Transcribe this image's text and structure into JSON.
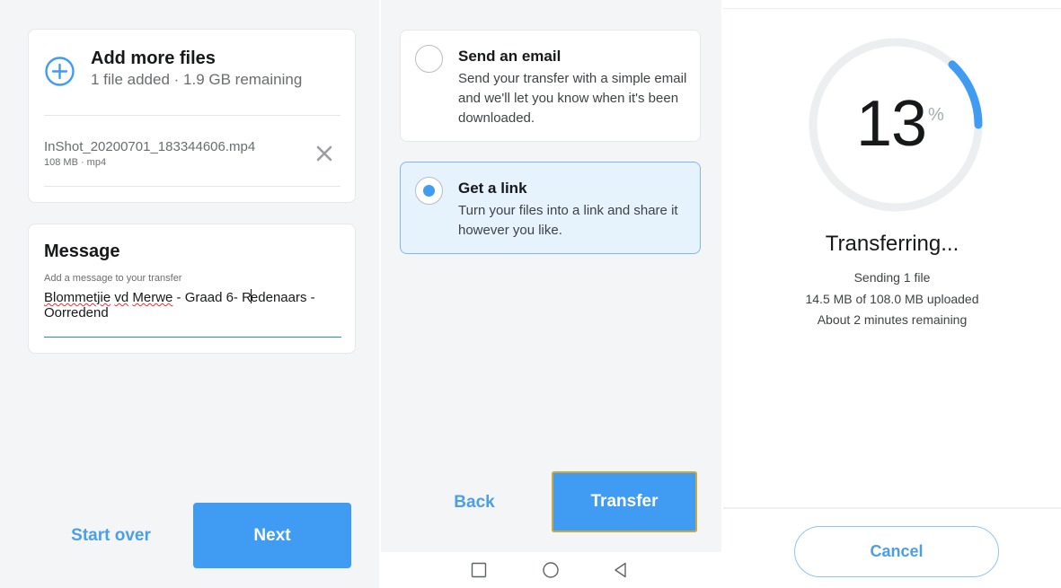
{
  "upload_step": {
    "add_files": {
      "title": "Add more files",
      "subtitle": "1 file added · 1.9 GB remaining",
      "icon": "plus-circle-icon"
    },
    "file": {
      "name": "InShot_20200701_183344606.mp4",
      "meta": "108 MB · mp4",
      "remove_icon": "close-icon"
    },
    "message": {
      "title": "Message",
      "hint": "Add a message to your transfer",
      "value_parts": [
        "Blommetjie",
        " ",
        "vd",
        " ",
        "Merwe",
        " - Graad 6- R",
        "edenaars - Oorredend"
      ]
    },
    "start_over_label": "Start over",
    "next_label": "Next"
  },
  "delivery_step": {
    "options": [
      {
        "title": "Send an email",
        "description": "Send your transfer with a simple email and we'll let you know when it's been downloaded.",
        "selected": false
      },
      {
        "title": "Get a link",
        "description": "Turn your files into a link and share it however you like.",
        "selected": true
      }
    ],
    "back_label": "Back",
    "transfer_label": "Transfer",
    "nav_icons": [
      "recents-square-icon",
      "home-circle-icon",
      "back-triangle-icon"
    ]
  },
  "progress_step": {
    "percent": 13,
    "percent_text": "13",
    "percent_symbol": "%",
    "title": "Transferring...",
    "sending": "Sending 1 file",
    "uploaded": "14.5 MB of 108.0 MB uploaded",
    "remaining": "About 2 minutes remaining",
    "cancel_label": "Cancel"
  },
  "colors": {
    "accent": "#409cf2",
    "accent_text": "#4a9fe6",
    "selected_bg": "#e6f2fc",
    "spellcheck": "#e0322f",
    "track": "#eceef0"
  }
}
